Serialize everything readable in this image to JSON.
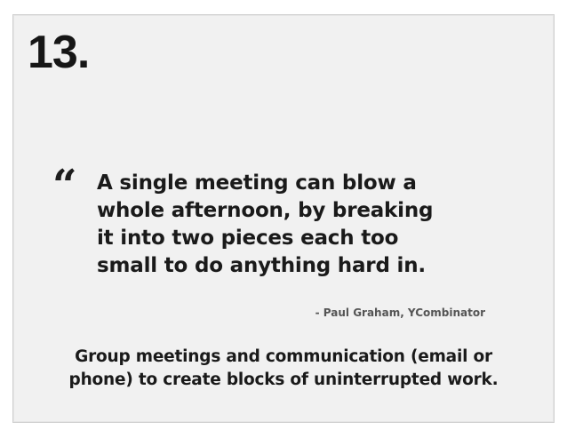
{
  "slide": {
    "number": "13.",
    "quote_mark": "“",
    "quote_lines": [
      "A single meeting can blow a",
      "whole afternoon, by breaking",
      "it into two pieces each too",
      "small to do anything hard in."
    ],
    "attribution": "- Paul Graham, YCombinator",
    "takeaway_lines": [
      "Group meetings and communication (email or",
      "phone) to create blocks of uninterrupted work."
    ]
  }
}
